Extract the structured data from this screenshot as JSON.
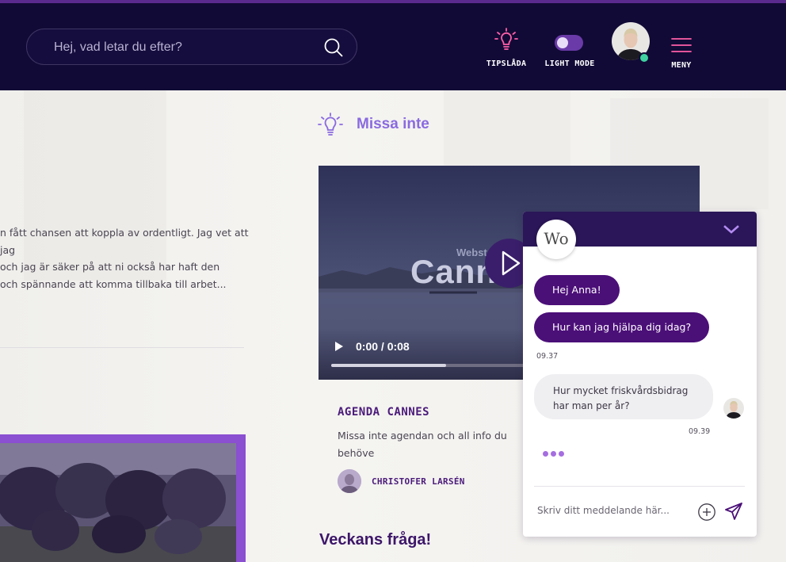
{
  "header": {
    "search_placeholder": "Hej, vad letar du efter?",
    "tips_label": "TIPSLÅDA",
    "mode_label": "LIGHT MODE",
    "menu_label": "MENY"
  },
  "post": {
    "excerpt": "n fått chansen att koppla av ordentligt. Jag vet att jag\noch jag är säker på att ni också har haft den\n och spännande att komma tillbaka till arbet..."
  },
  "missa_inte": {
    "title": "Missa inte",
    "video": {
      "overlay_small": "Webst",
      "overlay_big": "Cann",
      "time": "0:00 / 0:08",
      "progress": 0.33
    },
    "agenda_title": "AGENDA CANNES",
    "agenda_text": "Missa inte agendan och all info du behöve\nevent – vår höstkonferens i Cannes! Ladda",
    "author": "CHRISTOFER LARSÉN"
  },
  "veckans": {
    "title": "Veckans fråga!"
  },
  "chat": {
    "logo_text": "Wo",
    "messages": [
      {
        "from": "bot",
        "text": "Hej Anna!"
      },
      {
        "from": "bot",
        "text": "Hur kan jag hjälpa dig idag?"
      },
      {
        "from": "user",
        "text": "Hur mycket friskvårdsbidrag har man per år?"
      }
    ],
    "bot_time": "09.37",
    "user_time": "09.39",
    "input_placeholder": "Skriv ditt meddelande här..."
  },
  "colors": {
    "header_bg": "#110a36",
    "accent_purple": "#4b0f78",
    "accent_light": "#8a6ae0",
    "online": "#3fd2a0"
  },
  "icons": [
    "search-icon",
    "lightbulb-icon",
    "toggle-icon",
    "hamburger-menu-icon",
    "play-icon",
    "chevron-down-icon",
    "plus-circle-icon",
    "send-icon"
  ]
}
